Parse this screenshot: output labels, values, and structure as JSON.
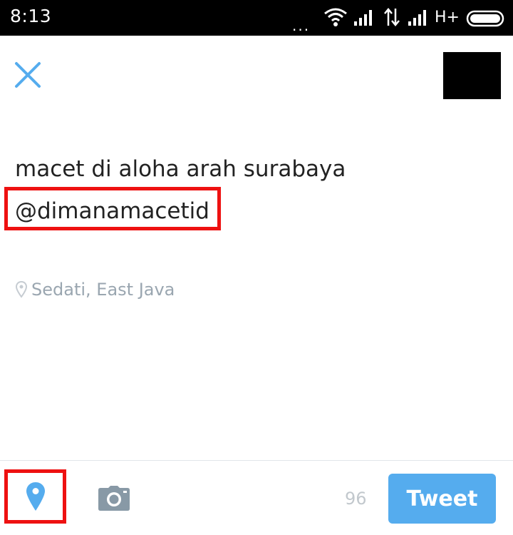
{
  "status_bar": {
    "time": "8:13",
    "dots": "...",
    "network": "H+"
  },
  "compose": {
    "text_line1": "macet di aloha arah surabaya",
    "mention": "@dimanamacetid"
  },
  "location": {
    "label": "Sedati, East Java"
  },
  "toolbar": {
    "char_count": "96",
    "tweet_label": "Tweet"
  },
  "colors": {
    "accent": "#55acee",
    "highlight_border": "#ee1111",
    "muted_text": "#9aa6b0"
  },
  "icons": [
    "close-icon",
    "location-pin-icon",
    "camera-icon",
    "wifi-icon",
    "signal-icon",
    "battery-icon"
  ]
}
